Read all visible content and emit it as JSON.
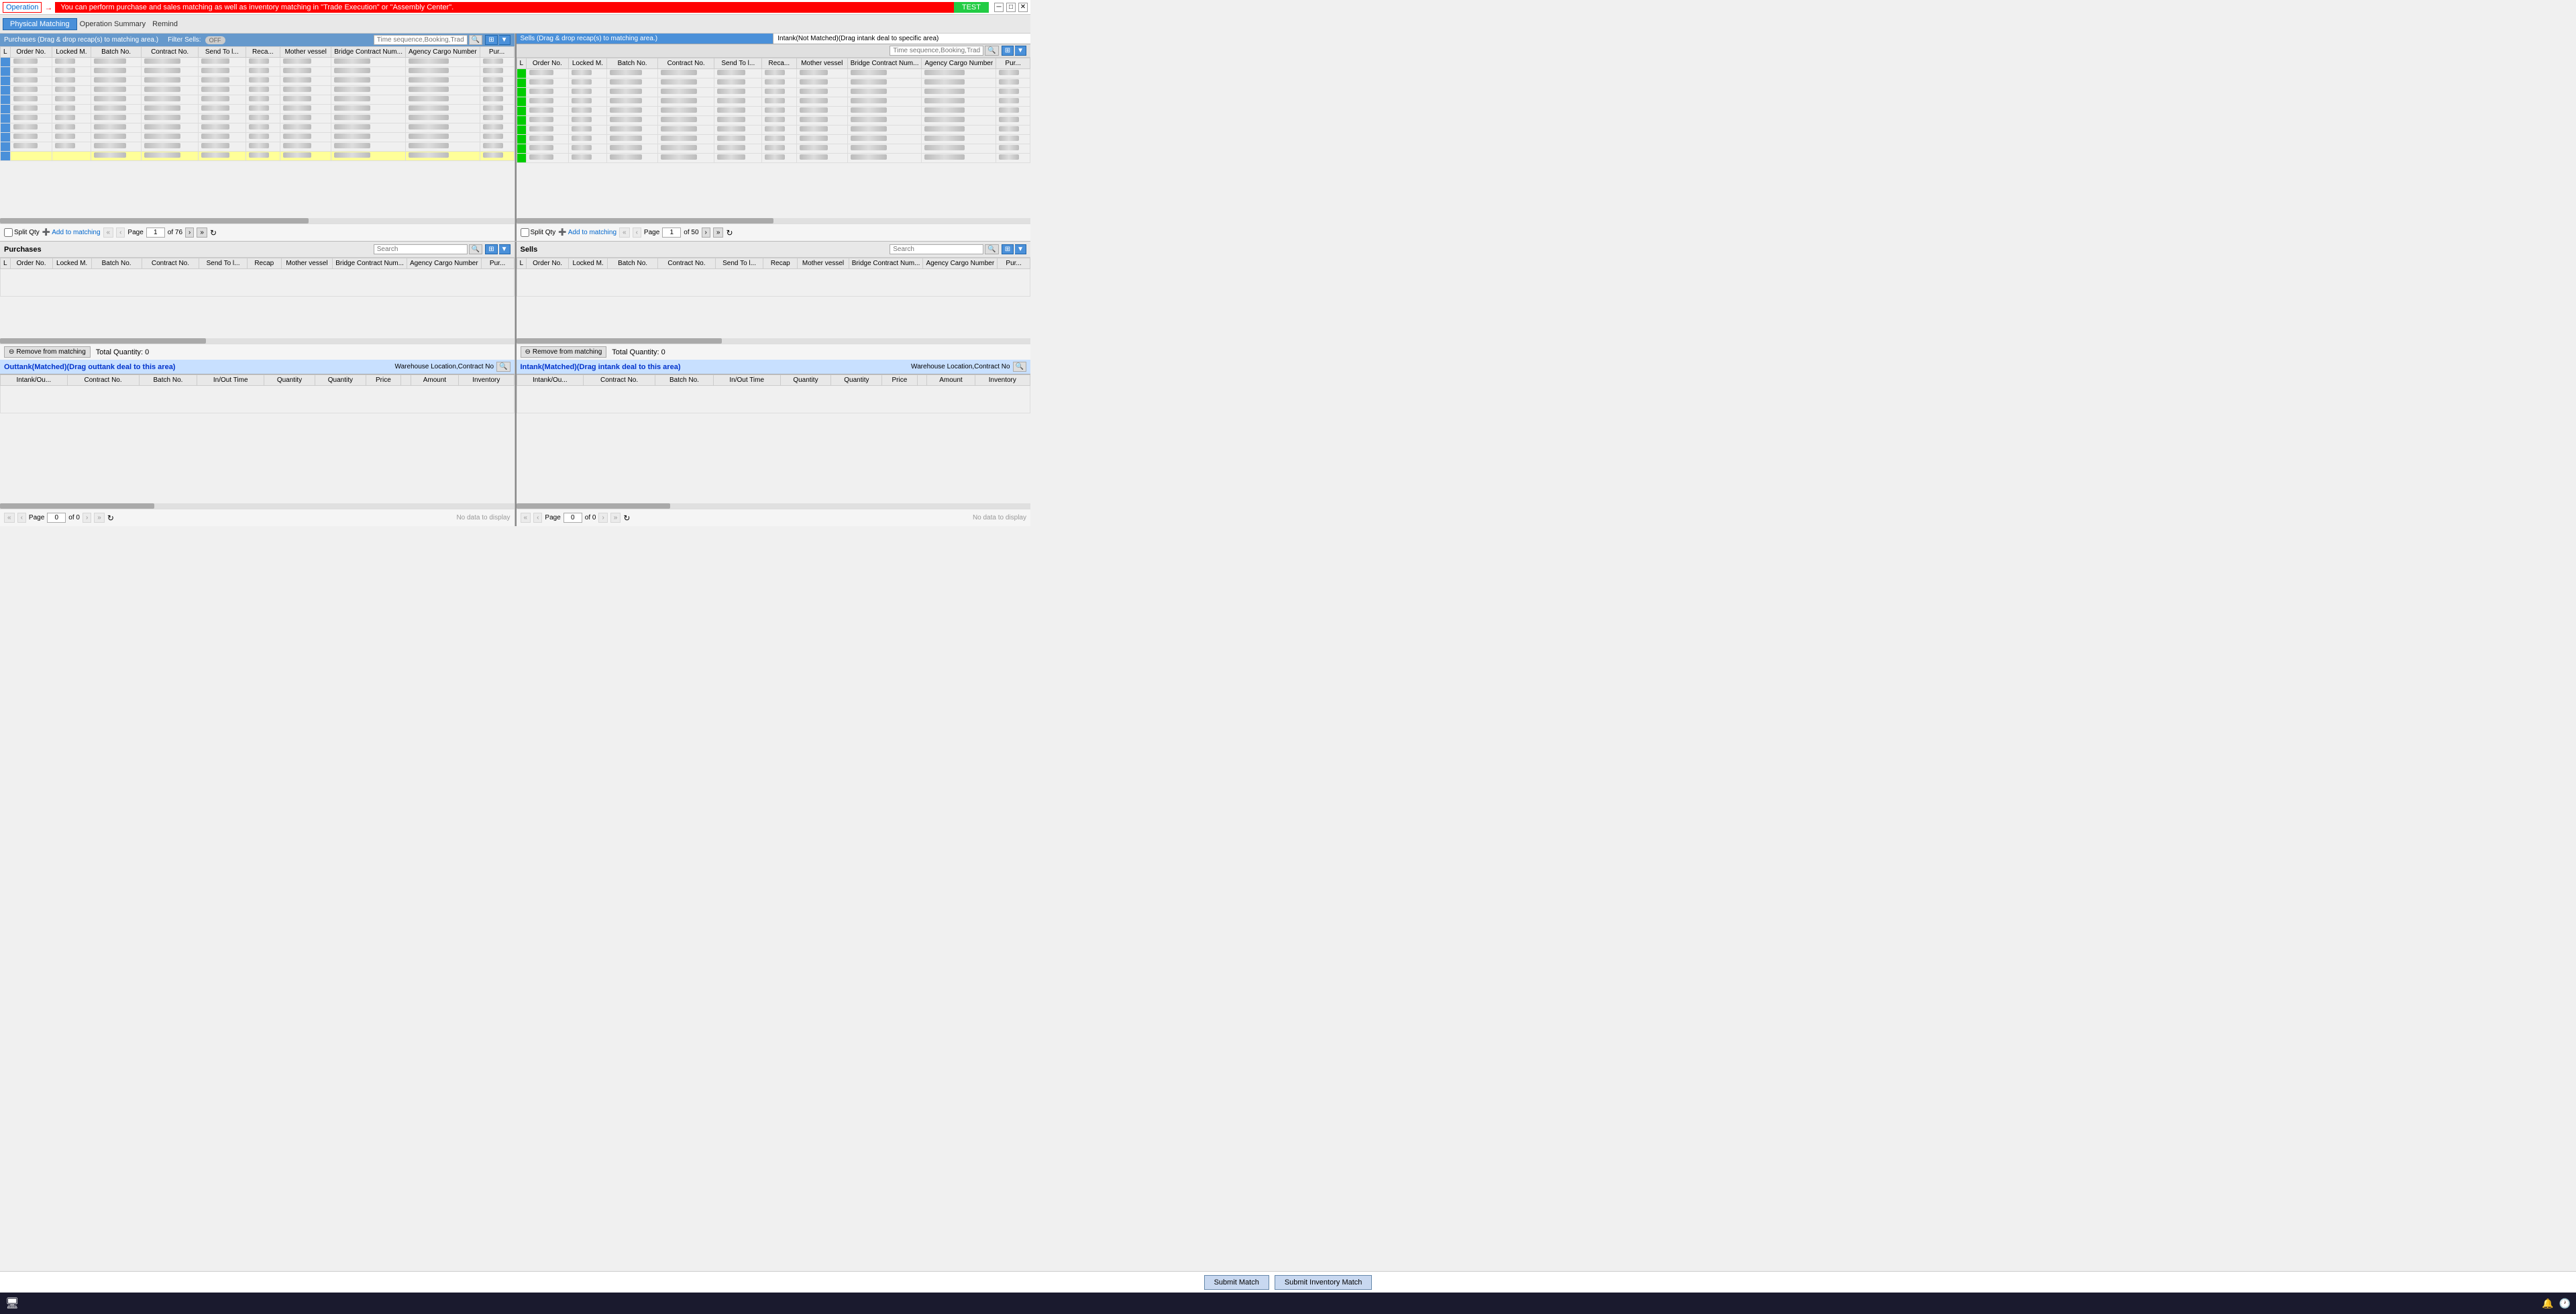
{
  "topBar": {
    "operationLabel": "Operation",
    "infoBanner": "You can perform purchase and sales matching as well as inventory matching in \"Trade Execution\" or \"Assembly Center\".",
    "testBtn": "TEST"
  },
  "nav": {
    "tabs": [
      {
        "id": "physical-matching",
        "label": "Physical Matching",
        "active": true
      },
      {
        "id": "operation-summary",
        "label": "Operation Summary",
        "active": false
      },
      {
        "id": "remind",
        "label": "Remind",
        "active": false
      }
    ]
  },
  "leftTopPanel": {
    "header": "Purchases (Drag & drop recap(s) to matching area.)",
    "filterSells": "Filter Sells:",
    "toggleState": "OFF",
    "searchPlaceholder": "Time sequence,Booking,Trader,P",
    "columns": [
      "L",
      "Order No.",
      "Locked M.",
      "Batch No.",
      "Contract No.",
      "Send To l...",
      "Reca...",
      "Mother vessel",
      "Bridge Contract Num...",
      "Agency Cargo Number",
      "Pur..."
    ],
    "rows": [
      {
        "color": "blue",
        "highlighted": false
      },
      {
        "color": "blue",
        "highlighted": false
      },
      {
        "color": "blue",
        "highlighted": false
      },
      {
        "color": "blue",
        "highlighted": false
      },
      {
        "color": "blue",
        "highlighted": false
      },
      {
        "color": "blue",
        "highlighted": false
      },
      {
        "color": "blue",
        "highlighted": false
      },
      {
        "color": "blue",
        "highlighted": false
      },
      {
        "color": "blue",
        "highlighted": false
      },
      {
        "color": "blue",
        "highlighted": false
      },
      {
        "color": "blue",
        "highlighted": true
      }
    ],
    "pagination": {
      "page": "1",
      "of": "of 76"
    },
    "splitQty": "Split Qty",
    "addToMatching": "Add to matching"
  },
  "rightTopPanel": {
    "header": "Sells (Drag & drop recap(s) to matching area.)",
    "headerBlue": "Sells (Drag & drop recap(s) to matching area.)",
    "headerIntank": "Intank(Not Matched)(Drag intank deal to specific area)",
    "searchPlaceholder": "Time sequence,Booking,Trader,P",
    "columns": [
      "L",
      "Order No.",
      "Locked M.",
      "Batch No.",
      "Contract No.",
      "Send To l...",
      "Reca...",
      "Mother vessel",
      "Bridge Contract Num...",
      "Agency Cargo Number",
      "Pur..."
    ],
    "rows": [
      {
        "color": "green",
        "highlighted": false
      },
      {
        "color": "green",
        "highlighted": false
      },
      {
        "color": "green",
        "highlighted": false
      },
      {
        "color": "green",
        "highlighted": false
      },
      {
        "color": "green",
        "highlighted": false
      },
      {
        "color": "green",
        "highlighted": false
      },
      {
        "color": "green",
        "highlighted": false
      },
      {
        "color": "green",
        "highlighted": false
      },
      {
        "color": "green",
        "highlighted": false
      },
      {
        "color": "green",
        "highlighted": false
      }
    ],
    "pagination": {
      "page": "1",
      "of": "of 50"
    },
    "splitQty": "Split Qty",
    "addToMatching": "Add to matching"
  },
  "leftBottomPanel": {
    "matchingHeader": "Purchases",
    "searchPlaceholder": "Search",
    "columns": [
      "L",
      "Order No.",
      "Locked M.",
      "Batch No.",
      "Contract No.",
      "Send To l...",
      "Recap",
      "Mother vessel",
      "Bridge Contract Num...",
      "Agency Cargo Number",
      "Pur..."
    ],
    "removeBtn": "Remove from matching",
    "totalQty": "Total Quantity: 0",
    "outtankHeader": "Outtank(Matched)(Drag outtank deal to this area)",
    "warehouseFilter": "Warehouse Location,Contract No",
    "outtankColumns": [
      "Intank/Ou...",
      "Contract No.",
      "Batch No.",
      "In/Out Time",
      "Quantity",
      "Quantity",
      "Price",
      "",
      "Amount",
      "Inventory"
    ],
    "pagination": {
      "page": "0",
      "of": "of 0"
    },
    "noData": "No data to display"
  },
  "rightBottomPanel": {
    "matchingHeader": "Sells",
    "searchPlaceholder": "Search",
    "columns": [
      "L",
      "Order No.",
      "Locked M.",
      "Batch No.",
      "Contract No.",
      "Send To l...",
      "Recap",
      "Mother vessel",
      "Bridge Contract Num...",
      "Agency Cargo Number",
      "Pur..."
    ],
    "removeBtn": "Remove from matching",
    "totalQty": "Total Quantity: 0",
    "intankHeader": "Intank(Matched)(Drag intank deal to this area)",
    "warehouseFilter": "Warehouse Location,Contract No",
    "intankColumns": [
      "Intank/Ou...",
      "Contract No.",
      "Batch No.",
      "In/Out Time",
      "Quantity",
      "Quantity",
      "Price",
      "",
      "Amount",
      "Inventory"
    ],
    "pagination": {
      "page": "0",
      "of": "of 0"
    },
    "noData": "No data to display"
  },
  "footer": {
    "submitMatch": "Submit Match",
    "submitInventoryMatch": "Submit Inventory Match"
  },
  "colors": {
    "blue": "#4a90d9",
    "green": "#00cc00",
    "yellow": "#ffff99",
    "headerBg": "#b8d4f0",
    "activeBg": "#4a90d9"
  }
}
